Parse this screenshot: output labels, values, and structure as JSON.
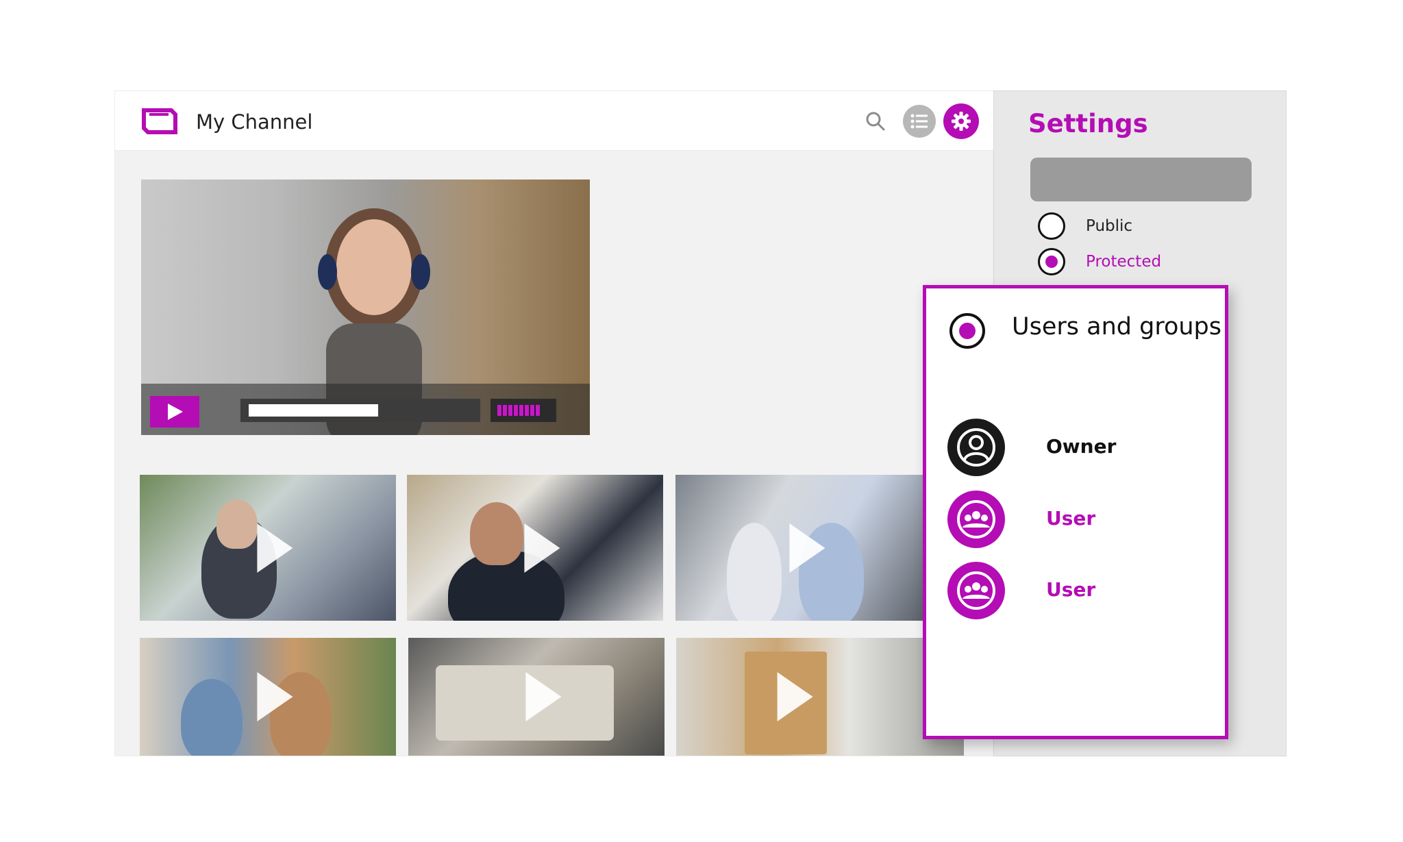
{
  "header": {
    "title": "My Channel",
    "icons": [
      "channel-logo-icon",
      "search-icon",
      "list-icon",
      "gear-icon"
    ]
  },
  "player": {
    "progress_fraction": 0.58,
    "volume_fraction": 0.82
  },
  "thumbnails": [
    {
      "icon": "play-icon"
    },
    {
      "icon": "play-icon"
    },
    {
      "icon": "play-icon"
    },
    {
      "icon": "play-icon"
    },
    {
      "icon": "play-icon"
    },
    {
      "icon": "play-icon"
    }
  ],
  "settings": {
    "title": "Settings",
    "options": [
      {
        "label": "Public",
        "selected": false
      },
      {
        "label": "Protected",
        "selected": true
      }
    ]
  },
  "access_popover": {
    "title": "Users and groups",
    "selected": true,
    "members": [
      {
        "label": "Owner",
        "icon": "user-icon"
      },
      {
        "label": "User",
        "icon": "group-icon"
      },
      {
        "label": "User",
        "icon": "group-icon"
      }
    ]
  },
  "colors": {
    "accent": "#b40db5",
    "panel_bg": "#e8e8e8",
    "content_bg": "#f2f2f2"
  }
}
